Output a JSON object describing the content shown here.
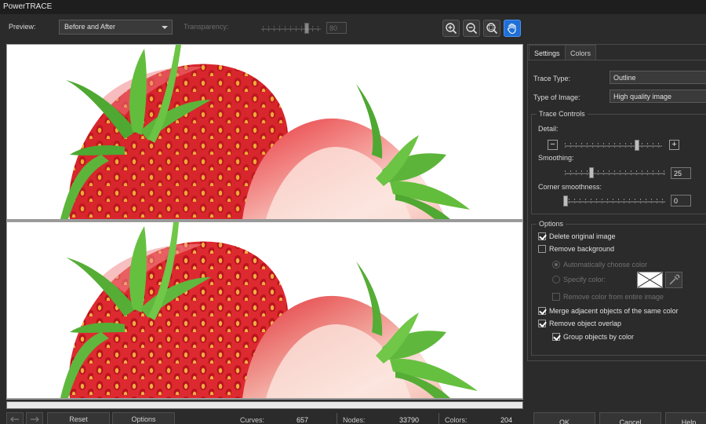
{
  "window": {
    "title": "PowerTRACE"
  },
  "toolbar": {
    "preview_label": "Preview:",
    "preview_value": "Before and After",
    "transparency_label": "Transparency:",
    "transparency_value": "80",
    "transparency_level": 0.78,
    "zoom_buttons": [
      "zoom-in-icon",
      "zoom-out-icon",
      "zoom-fit-icon",
      "pan-hand-icon"
    ]
  },
  "tabs": [
    "Settings",
    "Colors"
  ],
  "settings": {
    "trace_type_label": "Trace Type:",
    "trace_type_value": "Outline",
    "image_type_label": "Type of Image:",
    "image_type_value": "High quality image",
    "trace_controls_title": "Trace Controls",
    "detail_label": "Detail:",
    "detail_level": 0.75,
    "smoothing_label": "Smoothing:",
    "smoothing_value": "25",
    "corner_label": "Corner smoothness:",
    "corner_value": "0"
  },
  "options": {
    "title": "Options",
    "items": [
      {
        "label": "Delete original image",
        "checked": true,
        "enabled": true
      },
      {
        "label": "Remove background",
        "checked": false,
        "enabled": true
      },
      {
        "label": "Automatically choose color",
        "kind": "radio",
        "checked": true,
        "enabled": false
      },
      {
        "label": "Specify color:",
        "kind": "radio",
        "checked": false,
        "enabled": false
      },
      {
        "label": "Remove color from entire image",
        "checked": false,
        "enabled": false
      },
      {
        "label": "Merge adjacent objects of the same color",
        "checked": true,
        "enabled": true
      },
      {
        "label": "Remove object overlap",
        "checked": true,
        "enabled": true
      },
      {
        "label": "Group objects by color",
        "checked": true,
        "enabled": true
      }
    ]
  },
  "status": {
    "reset_label": "Reset",
    "options_label": "Options",
    "curves_label": "Curves:",
    "curves_value": "657",
    "nodes_label": "Nodes:",
    "nodes_value": "33790",
    "colors_label": "Colors:",
    "colors_value": "204"
  },
  "buttons": {
    "ok": "OK",
    "cancel": "Cancel",
    "help": "Help"
  },
  "colors": {
    "accent": "#1f6fd6",
    "strawberry": "#d8262d",
    "leaf": "#5cb53a"
  }
}
